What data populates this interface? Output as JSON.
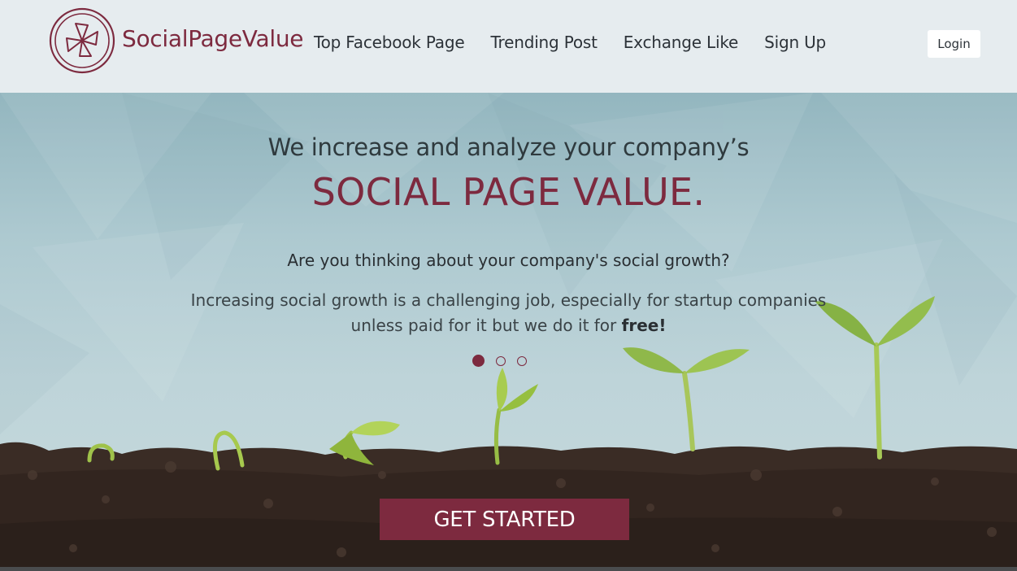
{
  "brand": {
    "name": "SocialPageValue",
    "color": "#7d2a3f",
    "logo_icon": "pinwheel-logo-icon"
  },
  "nav": {
    "items": [
      {
        "label": "Top Facebook Page"
      },
      {
        "label": "Trending Post"
      },
      {
        "label": "Exchange Like"
      },
      {
        "label": "Sign Up"
      }
    ],
    "login_label": "Login"
  },
  "hero": {
    "subtitle": "We increase and analyze your company’s",
    "title": "SOCIAL PAGE VALUE.",
    "question": "Are you thinking about your company's social growth?",
    "body_line1": "Increasing social growth is a challenging job, especially for startup companies",
    "body_line2_prefix": "unless paid for it but we do it for ",
    "body_line2_bold": "free!",
    "carousel": {
      "total_slides": 3,
      "active_slide": 1
    },
    "cta_label": "GET STARTED",
    "background_image": "seedlings-growing-in-soil"
  },
  "colors": {
    "accent": "#7d2a3f",
    "header_bg": "#e6ecef",
    "text_dark": "#2d3339",
    "sky": "#adc9d0",
    "soil": "#3a2c25"
  }
}
